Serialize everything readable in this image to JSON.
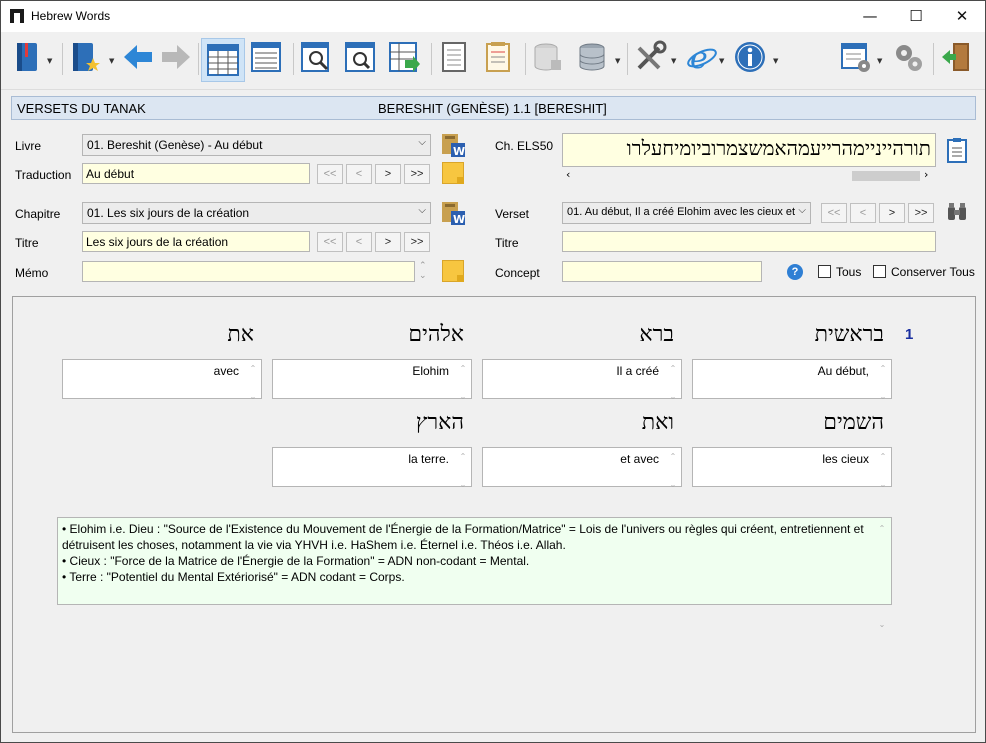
{
  "window": {
    "title": "Hebrew Words",
    "controls": {
      "minimize": "—",
      "maximize": "☐",
      "close": "✕"
    }
  },
  "toolbar": {
    "buttons": [
      "book-icon",
      "bookmark-star-icon",
      "back-arrow-icon",
      "forward-arrow-icon",
      "grid-view-icon",
      "list-view-icon",
      "search-doc-icon",
      "search-page-icon",
      "export-grid-icon",
      "document-icon",
      "notepad-icon",
      "database-gray-icon",
      "database-icon",
      "tools-icon",
      "internet-explorer-icon",
      "info-icon",
      "settings-panel-icon",
      "gears-icon",
      "exit-door-icon"
    ],
    "active": "grid-view-icon"
  },
  "header": {
    "left": "VERSETS DU TANAK",
    "center": "BERESHIT (GENÈSE) 1.1 [BERESHIT]"
  },
  "form": {
    "livre_label": "Livre",
    "livre_value": "01. Bereshit (Genèse) - Au début",
    "traduction_label": "Traduction",
    "traduction_value": "Au début",
    "chapitre_label": "Chapitre",
    "chapitre_value": "01. Les six jours de la création",
    "titre_label": "Titre",
    "titre_value": "Les six jours de la création",
    "memo_label": "Mémo",
    "memo_value": "",
    "els_label": "Ch. ELS50",
    "els_value": "תורהייניימהרייעמהאמשצמרוביומיחעלרו",
    "verset_label": "Verset",
    "verset_value": "01. Au début, Il a créé Elohim avec les cieux et",
    "titre2_label": "Titre",
    "titre2_value": "",
    "concept_label": "Concept",
    "concept_value": "",
    "tous_label": "Tous",
    "conserver_label": "Conserver Tous",
    "nav": {
      "first": "<<",
      "prev": "<",
      "next": ">",
      "last": ">>"
    }
  },
  "verse": {
    "number": "1",
    "words": [
      {
        "hebrew": "בראשית",
        "translation": "Au début,"
      },
      {
        "hebrew": "ברא",
        "translation": "Il a créé"
      },
      {
        "hebrew": "אלהים",
        "translation": "Elohim"
      },
      {
        "hebrew": "את",
        "translation": "avec"
      },
      {
        "hebrew": "השמים",
        "translation": "les cieux"
      },
      {
        "hebrew": "ואת",
        "translation": "et avec"
      },
      {
        "hebrew": "הארץ",
        "translation": "la terre."
      }
    ]
  },
  "notes": [
    "• Elohim i.e. Dieu : \"Source de l'Existence du Mouvement de l'Énergie de la Formation/Matrice\" = Lois de l'univers ou règles qui créent, entretiennent et détruisent les choses, notamment la vie via YHVH i.e. HaShem i.e. Éternel i.e. Théos i.e. Allah.",
    "• Cieux : \"Force de la Matrice de l'Énergie de la Formation\" = ADN non-codant = Mental.",
    "• Terre : \"Potentiel du Mental Extériorisé\" = ADN codant = Corps."
  ]
}
